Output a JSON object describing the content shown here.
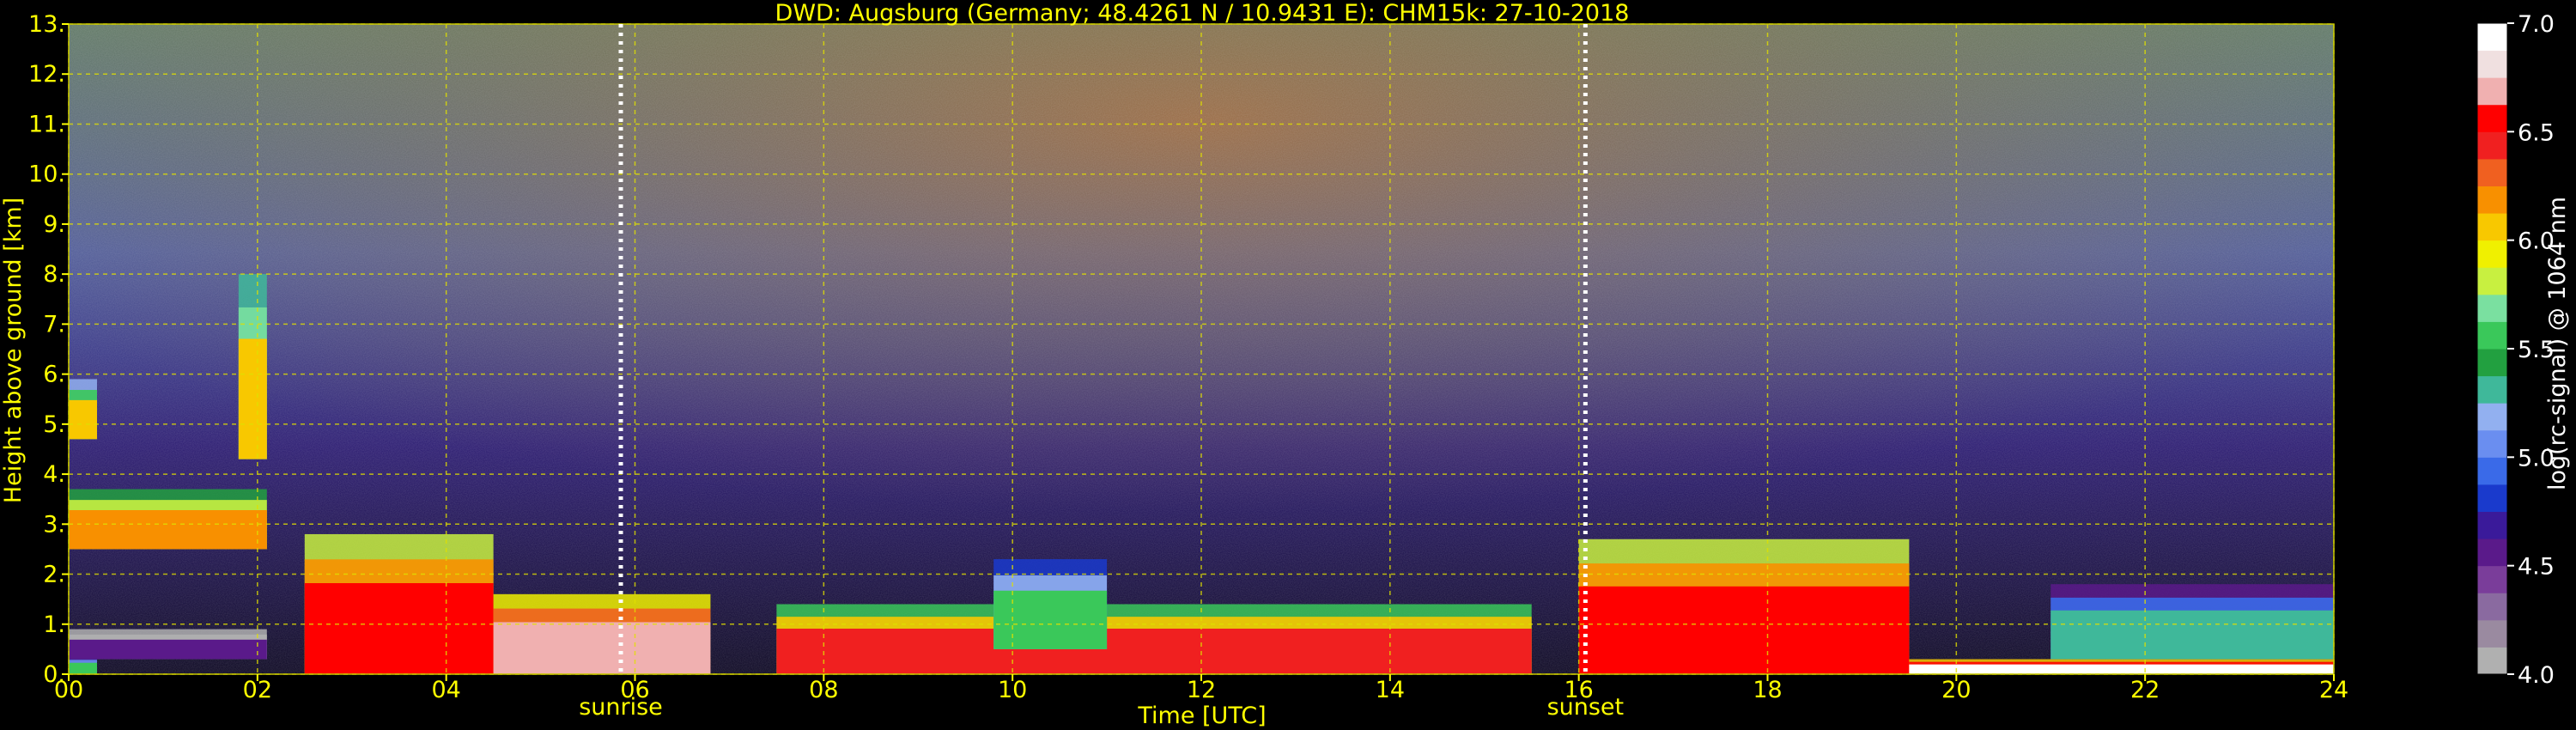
{
  "chart_data": {
    "type": "heatmap",
    "title": "DWD: Augsburg (Germany; 48.4261 N / 10.9431 E):    CHM15k: 27-10-2018",
    "xlabel": "Time [UTC]",
    "ylabel": "Height above ground [km]",
    "xlim": [
      0,
      24
    ],
    "ylim": [
      0,
      13
    ],
    "x_ticks": [
      "00",
      "02",
      "04",
      "06",
      "08",
      "10",
      "12",
      "14",
      "16",
      "18",
      "20",
      "22",
      "24"
    ],
    "y_ticks": [
      "0.",
      "1.",
      "2.",
      "3.",
      "4.",
      "5.",
      "6.",
      "7.",
      "8.",
      "9.",
      "10.",
      "11.",
      "12.",
      "13."
    ],
    "grid": true,
    "events": [
      {
        "label": "sunrise",
        "time": 5.85
      },
      {
        "label": "sunset",
        "time": 16.07
      }
    ],
    "colorbar": {
      "label": "log(rc-signal) @ 1064 nm",
      "range": [
        4.0,
        7.0
      ],
      "ticks": [
        "4.0",
        "4.5",
        "5.0",
        "5.5",
        "6.0",
        "6.5",
        "7.0"
      ],
      "colors": [
        "#b0b0b0",
        "#9a8aa0",
        "#8a6aa0",
        "#7a3d9a",
        "#5a1a8a",
        "#3a1a9a",
        "#1a3acc",
        "#3a6ae8",
        "#6a8ef0",
        "#92b0f0",
        "#3fb89a",
        "#22a040",
        "#3ac85a",
        "#7ae0a0",
        "#c8f040",
        "#f0f000",
        "#f8c800",
        "#f89000",
        "#f06020",
        "#f02020",
        "#ff0000",
        "#f0b0b0",
        "#f0e0e0",
        "#ffffff"
      ]
    },
    "layers": [
      {
        "start": 0.0,
        "end": 0.3,
        "base": 0.0,
        "top": 0.35,
        "level": 5.5
      },
      {
        "start": 0.0,
        "end": 2.1,
        "base": 0.3,
        "top": 0.9,
        "level": 4.5
      },
      {
        "start": 0.0,
        "end": 2.1,
        "base": 2.5,
        "top": 3.7,
        "level": 6.2
      },
      {
        "start": 0.0,
        "end": 0.3,
        "base": 4.7,
        "top": 5.9,
        "level": 6.0
      },
      {
        "start": 1.8,
        "end": 2.1,
        "base": 4.3,
        "top": 8.0,
        "level": 6.1
      },
      {
        "start": 2.5,
        "end": 4.5,
        "base": 0.0,
        "top": 2.8,
        "level": 6.6
      },
      {
        "start": 4.5,
        "end": 6.8,
        "base": 0.0,
        "top": 1.6,
        "level": 6.7
      },
      {
        "start": 7.5,
        "end": 15.5,
        "base": 0.0,
        "top": 1.4,
        "level": 6.4
      },
      {
        "start": 9.8,
        "end": 11.0,
        "base": 0.5,
        "top": 2.3,
        "level": 5.6
      },
      {
        "start": 16.0,
        "end": 19.5,
        "base": 0.0,
        "top": 2.7,
        "level": 6.6
      },
      {
        "start": 19.5,
        "end": 24.0,
        "base": 0.0,
        "top": 0.3,
        "level": 6.9
      },
      {
        "start": 21.0,
        "end": 24.0,
        "base": 0.3,
        "top": 1.8,
        "level": 5.3
      }
    ]
  }
}
